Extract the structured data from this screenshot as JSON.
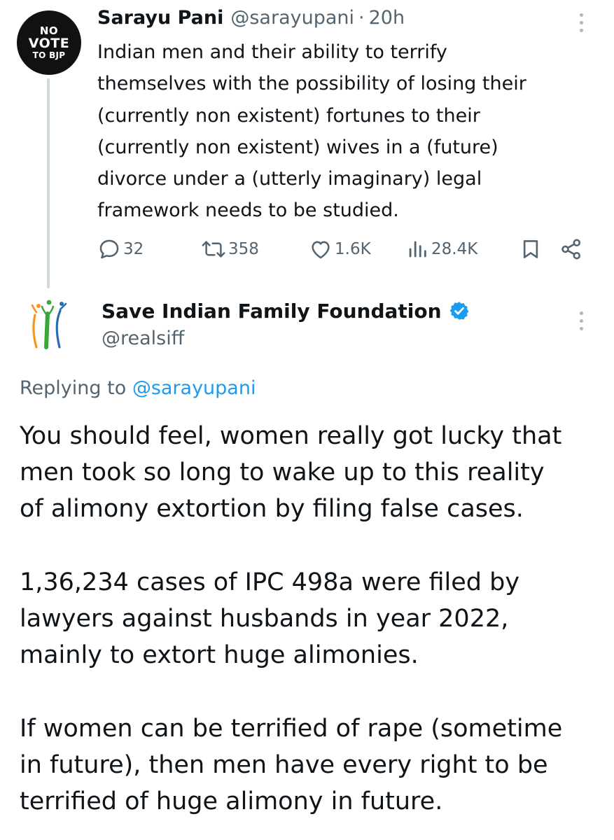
{
  "parent_tweet": {
    "avatar": {
      "line1": "NO",
      "line2": "VOTE",
      "line3": "TO BJP"
    },
    "display_name": "Sarayu Pani",
    "handle": "@sarayupani",
    "separator": "·",
    "timestamp": "20h",
    "text": "Indian men and their ability to terrify\nthemselves with the possibility of losing their\n(currently non existent) fortunes to their\n(currently non existent) wives in a (future)\ndivorce under a (utterly imaginary) legal\nframework needs to be studied.",
    "actions": {
      "replies": "32",
      "reposts": "358",
      "likes": "1.6K",
      "views": "28.4K"
    },
    "icons": [
      "reply-icon",
      "retweet-icon",
      "like-icon",
      "views-icon",
      "bookmark-icon",
      "share-icon",
      "more-icon"
    ]
  },
  "reply_tweet": {
    "display_name": "Save Indian Family Foundation",
    "handle": "@realsiff",
    "verified": true,
    "replying_prefix": "Replying to",
    "replying_to": "@sarayupani",
    "text": "You should feel, women really got lucky that\nmen took so long to wake up to this reality\nof alimony extortion by filing false cases.\n\n1,36,234 cases of IPC 498a were filed by\nlawyers against husbands in year 2022,\nmainly to extort huge alimonies.\n\nIf women can be terrified of rape (sometime\nin future), then men have every right to be\nterrified of huge alimony in future."
  },
  "colors": {
    "text_primary": "#0f1419",
    "text_secondary": "#536471",
    "link": "#1d9bf0",
    "thread_line": "#cfd9de",
    "verified_badge": "#1d9bf0",
    "logo_orange": "#f7941d",
    "logo_green": "#39a935",
    "logo_blue": "#2b6cb0"
  }
}
